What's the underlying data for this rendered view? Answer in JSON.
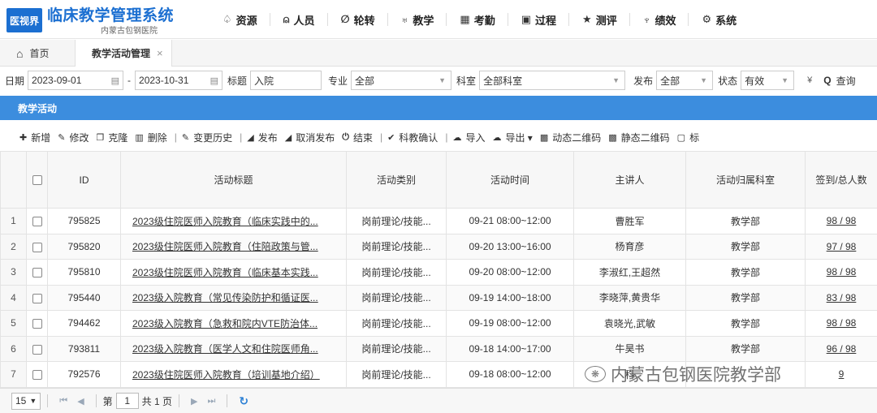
{
  "header": {
    "logo": "医视界",
    "title": "临床教学管理系统",
    "subtitle": "内蒙古包钢医院",
    "nav": [
      {
        "icon": "bell-icon",
        "glyph": "♤",
        "label": "资源"
      },
      {
        "icon": "user-icon",
        "glyph": "⍝",
        "label": "人员"
      },
      {
        "icon": "rotate-icon",
        "glyph": "∅",
        "label": "轮转"
      },
      {
        "icon": "stethoscope-icon",
        "glyph": "♅",
        "label": "教学"
      },
      {
        "icon": "calendar-icon",
        "glyph": "▦",
        "label": "考勤"
      },
      {
        "icon": "clipboard-icon",
        "glyph": "▣",
        "label": "过程"
      },
      {
        "icon": "star-icon",
        "glyph": "★",
        "label": "测评"
      },
      {
        "icon": "trophy-icon",
        "glyph": "♆",
        "label": "绩效"
      },
      {
        "icon": "gears-icon",
        "glyph": "⚙",
        "label": "系统"
      }
    ]
  },
  "tabs": {
    "home": "首页",
    "active": "教学活动管理",
    "close": "×"
  },
  "filters": {
    "date_label": "日期",
    "date_from": "2023-09-01",
    "date_to": "2023-10-31",
    "title_label": "标题",
    "title_value": "入院",
    "major_label": "专业",
    "major_value": "全部",
    "dept_label": "科室",
    "dept_value": "全部科室",
    "publish_label": "发布",
    "publish_value": "全部",
    "status_label": "状态",
    "status_value": "有效",
    "query": "查询"
  },
  "panel": {
    "title": "教学活动"
  },
  "toolbar": [
    {
      "icon": "plus-icon",
      "glyph": "✚",
      "label": "新增"
    },
    {
      "icon": "edit-icon",
      "glyph": "✎",
      "label": "修改"
    },
    {
      "icon": "copy-icon",
      "glyph": "❐",
      "label": "克隆"
    },
    {
      "icon": "trash-icon",
      "glyph": "▥",
      "label": "删除"
    },
    {
      "icon": "history-icon",
      "glyph": "✎",
      "label": "变更历史"
    },
    {
      "icon": "send-icon",
      "glyph": "◢",
      "label": "发布"
    },
    {
      "icon": "unsend-icon",
      "glyph": "◢",
      "label": "取消发布"
    },
    {
      "icon": "power-icon",
      "glyph": "⏻",
      "label": "结束"
    },
    {
      "icon": "check-icon",
      "glyph": "✔",
      "label": "科教确认"
    },
    {
      "icon": "upload-cloud-icon",
      "glyph": "☁",
      "label": "导入"
    },
    {
      "icon": "download-cloud-icon",
      "glyph": "☁",
      "label": "导出 ▾"
    },
    {
      "icon": "qrcode-icon",
      "glyph": "▩",
      "label": "动态二维码"
    },
    {
      "icon": "qrcode-static-icon",
      "glyph": "▩",
      "label": "静态二维码"
    },
    {
      "icon": "bookmark-icon",
      "glyph": "▢",
      "label": "标"
    }
  ],
  "table": {
    "columns": [
      "ID",
      "活动标题",
      "活动类别",
      "活动时间",
      "主讲人",
      "活动归属科室",
      "签到/总人数"
    ],
    "rows": [
      {
        "n": "1",
        "id": "795825",
        "title": "2023级住院医师入院教育（临床实践中的...",
        "category": "岗前理论/技能...",
        "time": "09-21 08:00~12:00",
        "speaker": "曹胜军",
        "dept": "教学部",
        "count": "98 / 98"
      },
      {
        "n": "2",
        "id": "795820",
        "title": "2023级住院医师入院教育（住陪政策与管...",
        "category": "岗前理论/技能...",
        "time": "09-20 13:00~16:00",
        "speaker": "杨育彦",
        "dept": "教学部",
        "count": "97 / 98"
      },
      {
        "n": "3",
        "id": "795810",
        "title": "2023级住院医师入院教育（临床基本实践...",
        "category": "岗前理论/技能...",
        "time": "09-20 08:00~12:00",
        "speaker": "李淑红,王超然",
        "dept": "教学部",
        "count": "98 / 98"
      },
      {
        "n": "4",
        "id": "795440",
        "title": "2023级入院教育（常见传染防护和循证医...",
        "category": "岗前理论/技能...",
        "time": "09-19 14:00~18:00",
        "speaker": "李晓萍,黄贵华",
        "dept": "教学部",
        "count": "83 / 98"
      },
      {
        "n": "5",
        "id": "794462",
        "title": "2023级入院教育（急救和院内VTE防治体...",
        "category": "岗前理论/技能...",
        "time": "09-19 08:00~12:00",
        "speaker": "袁晓光,武敏",
        "dept": "教学部",
        "count": "98 / 98"
      },
      {
        "n": "6",
        "id": "793811",
        "title": "2023级入院教育（医学人文和住院医师角...",
        "category": "岗前理论/技能...",
        "time": "09-18 14:00~17:00",
        "speaker": "牛昊书",
        "dept": "教学部",
        "count": "96 / 98"
      },
      {
        "n": "7",
        "id": "792576",
        "title": "2023级住院医师入院教育（培训基地介绍）",
        "category": "岗前理论/技能...",
        "time": "09-18 08:00~12:00",
        "speaker": "科",
        "dept": "",
        "count": "9"
      }
    ]
  },
  "pager": {
    "page_size": "15",
    "page_prefix": "第",
    "page_value": "1",
    "page_suffix": "共 1 页"
  },
  "watermark": "内蒙古包钢医院教学部"
}
